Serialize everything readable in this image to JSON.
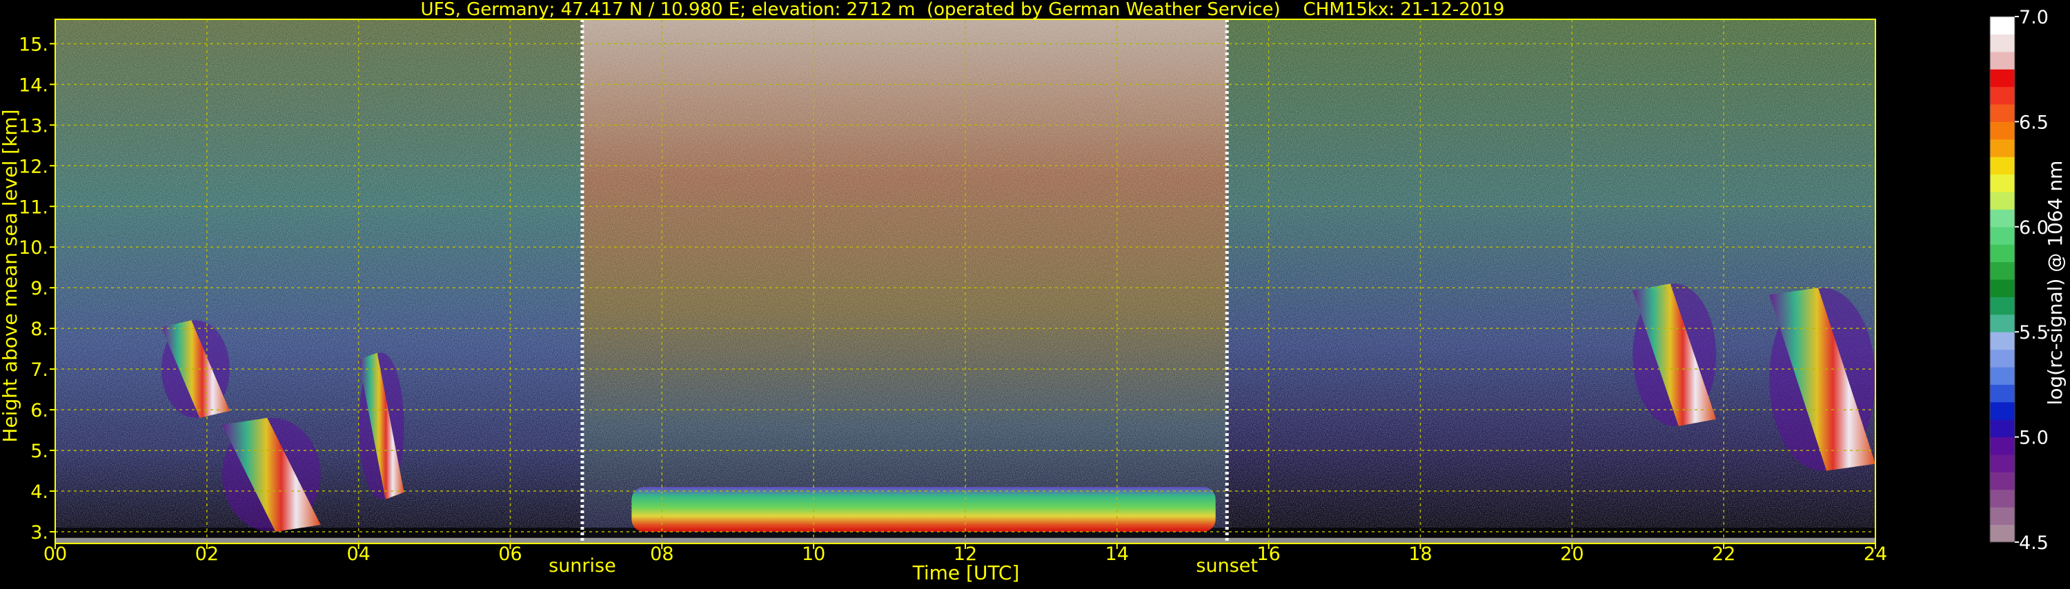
{
  "chart_data": {
    "type": "heatmap",
    "title": "UFS, Germany; 47.417 N / 10.980 E; elevation: 2712 m  (operated by German Weather Service)    CHM15kx: 21-12-2019",
    "xlabel": "Time [UTC]",
    "ylabel": "Height above mean sea level [km]",
    "xlim": [
      0,
      24
    ],
    "ylim": [
      2.712,
      15.6
    ],
    "x_ticks": [
      "00",
      "02",
      "04",
      "06",
      "08",
      "10",
      "12",
      "14",
      "16",
      "18",
      "20",
      "22",
      "24"
    ],
    "y_ticks": [
      "3.",
      "4.",
      "5.",
      "6.",
      "7.",
      "8.",
      "9.",
      "10.",
      "11.",
      "12.",
      "13.",
      "14.",
      "15."
    ],
    "grid": true,
    "markers": [
      {
        "label": "sunrise",
        "x": 6.95
      },
      {
        "label": "sunset",
        "x": 15.45
      }
    ],
    "colorbar": {
      "label": "log(rc-signal) @ 1064 nm",
      "range": [
        4.5,
        7.0
      ],
      "ticks": [
        "4.5",
        "5.0",
        "5.5",
        "6.0",
        "6.5",
        "7.0"
      ],
      "colors": [
        "#a98a9b",
        "#9a6d95",
        "#8b4f8f",
        "#7a2f8c",
        "#6a1a92",
        "#5a0f9b",
        "#2a10b0",
        "#0a22c8",
        "#2f55d8",
        "#5a82e3",
        "#7d9be6",
        "#9ab4ea",
        "#47b493",
        "#1e9c5c",
        "#138a2a",
        "#2aa83e",
        "#41c45a",
        "#58d57c",
        "#78e095",
        "#c5ee5a",
        "#ecf23b",
        "#f5d90e",
        "#f7a10a",
        "#f57c0a",
        "#f45a1b",
        "#f03520",
        "#e80d0d",
        "#e9b9b9",
        "#f0e0e0",
        "#ffffff"
      ]
    },
    "features": [
      {
        "type": "boundary-layer-aerosol",
        "x": [
          7.6,
          15.3
        ],
        "height_km": [
          3.0,
          4.1
        ]
      },
      {
        "type": "cloud",
        "x": [
          1.4,
          2.3
        ],
        "height_km": [
          5.8,
          8.2
        ]
      },
      {
        "type": "cloud",
        "x": [
          2.2,
          3.5
        ],
        "height_km": [
          3.0,
          5.8
        ]
      },
      {
        "type": "cloud",
        "x": [
          4.0,
          4.6
        ],
        "height_km": [
          3.8,
          7.4
        ]
      },
      {
        "type": "cloud",
        "x": [
          20.8,
          21.9
        ],
        "height_km": [
          5.6,
          9.1
        ]
      },
      {
        "type": "cloud",
        "x": [
          22.6,
          24.0
        ],
        "height_km": [
          4.5,
          9.0
        ]
      }
    ]
  },
  "colors": {
    "text": "#ffff00",
    "background": "#000000",
    "grid": "#b8b800",
    "marker": "#ffffff"
  }
}
